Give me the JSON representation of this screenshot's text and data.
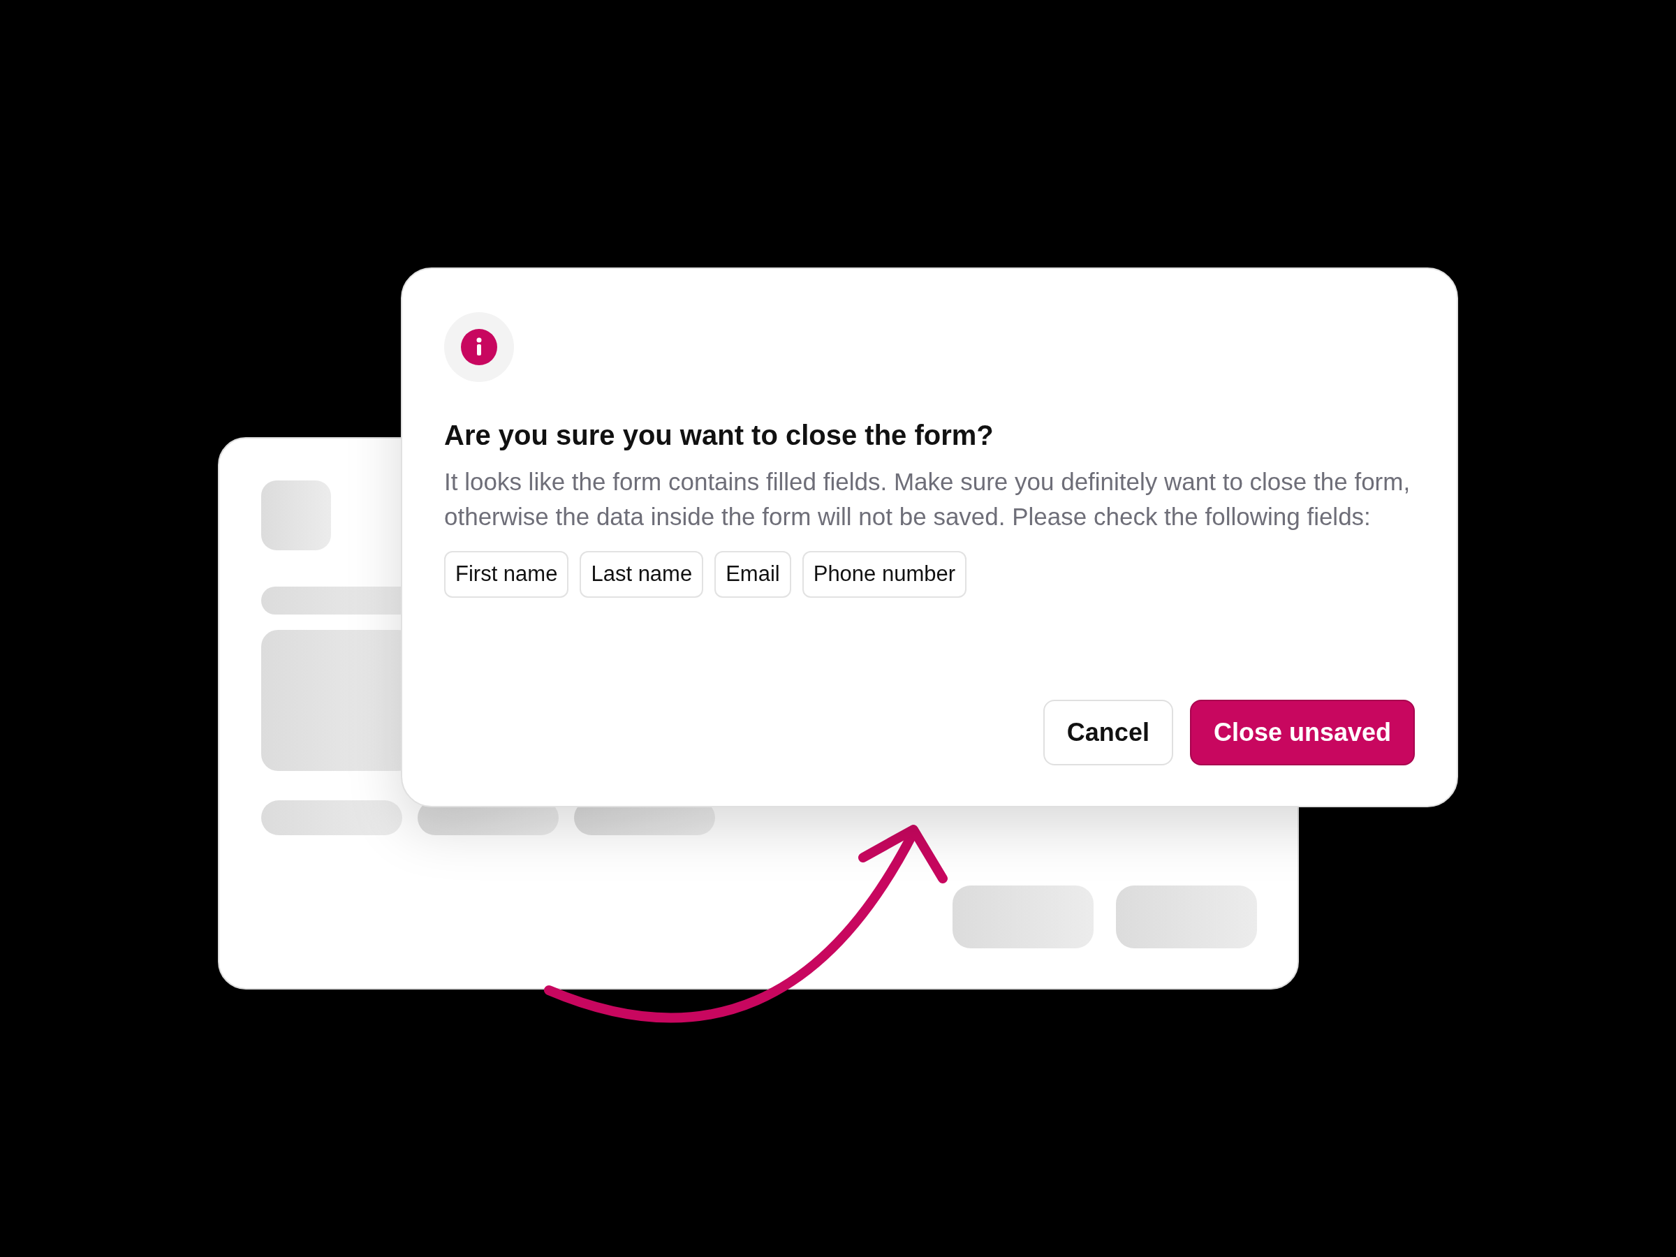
{
  "dialog": {
    "title": "Are you sure you want to close the form?",
    "message": "It looks like the form contains filled fields. Make sure you definitely want to close the form, otherwise the data inside the form will not be saved. Please check the following fields:",
    "fields": [
      "First name",
      "Last name",
      "Email",
      "Phone number"
    ],
    "buttons": [
      {
        "label": "Cancel",
        "kind": "secondary"
      },
      {
        "label": "Close unsaved",
        "kind": "primary"
      }
    ]
  }
}
